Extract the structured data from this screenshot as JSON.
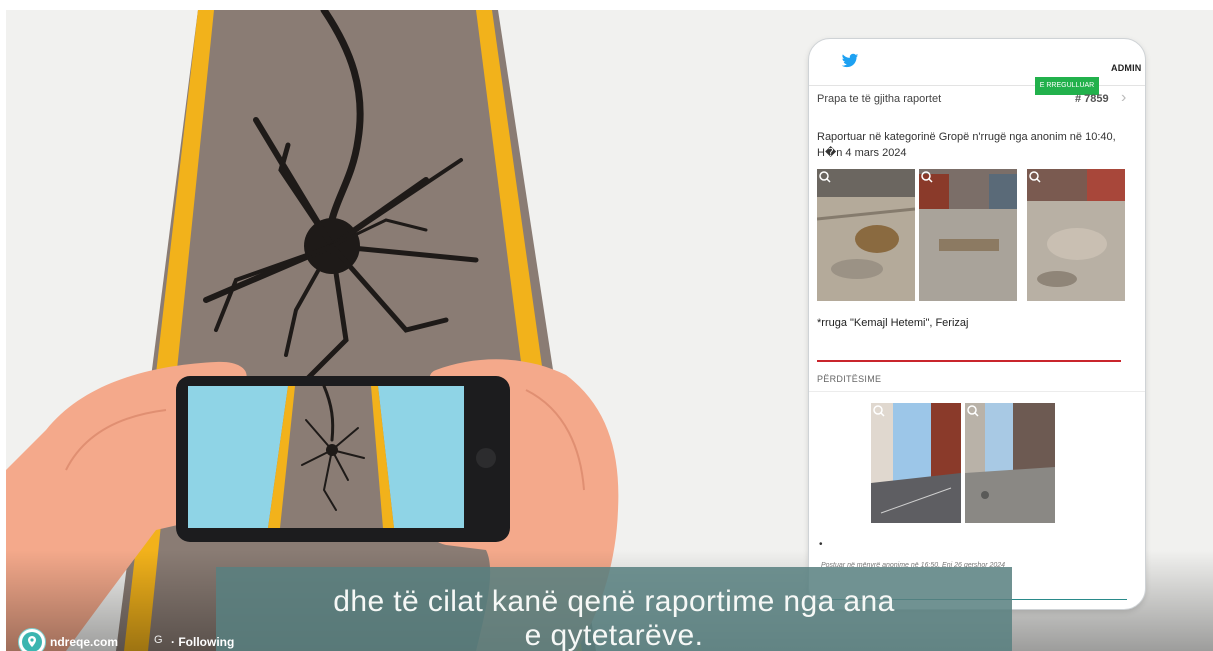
{
  "scene": {
    "icons": [
      "road-illustration",
      "crack-icon",
      "smartphone-icon",
      "hand-icon"
    ]
  },
  "phone": {
    "header": {
      "admin_label": "ADMIN"
    },
    "status_badge": "E RREGULLUAR",
    "back_link": "Prapa te të gjitha raportet",
    "report_id": "# 7859",
    "report_meta": "Raportuar në kategorinë Gropë n'rrugë nga anonim në 10:40, H�n 4 mars 2024",
    "photos": [
      {
        "name": "report-photo-1"
      },
      {
        "name": "report-photo-2"
      },
      {
        "name": "report-photo-3"
      }
    ],
    "address": "*rruga \"Kemajl Hetemi\", Ferizaj",
    "update_header": "PËRDITËSIME",
    "update_photos": [
      {
        "name": "update-photo-1"
      },
      {
        "name": "update-photo-2"
      }
    ],
    "bullet": "•",
    "posted": "Postuar në mënyrë anonime në 16:50, Enj 26 qershor 2024"
  },
  "subtitle": {
    "line1": "dhe të cilat kanë qenë raportime nga ana",
    "line2": "e qytetarëve."
  },
  "channel": {
    "name": "ndreqe.com",
    "mark": "G",
    "separator_action": "· Following"
  },
  "colors": {
    "road": "#8a7c74",
    "road_edge_yellow": "#f2b21b",
    "skin": "#f4a98b",
    "screen_sky": "#8fd4e6",
    "badge_green": "#22b14c",
    "update_rule": "#c9252c",
    "overlay": "#588080"
  }
}
